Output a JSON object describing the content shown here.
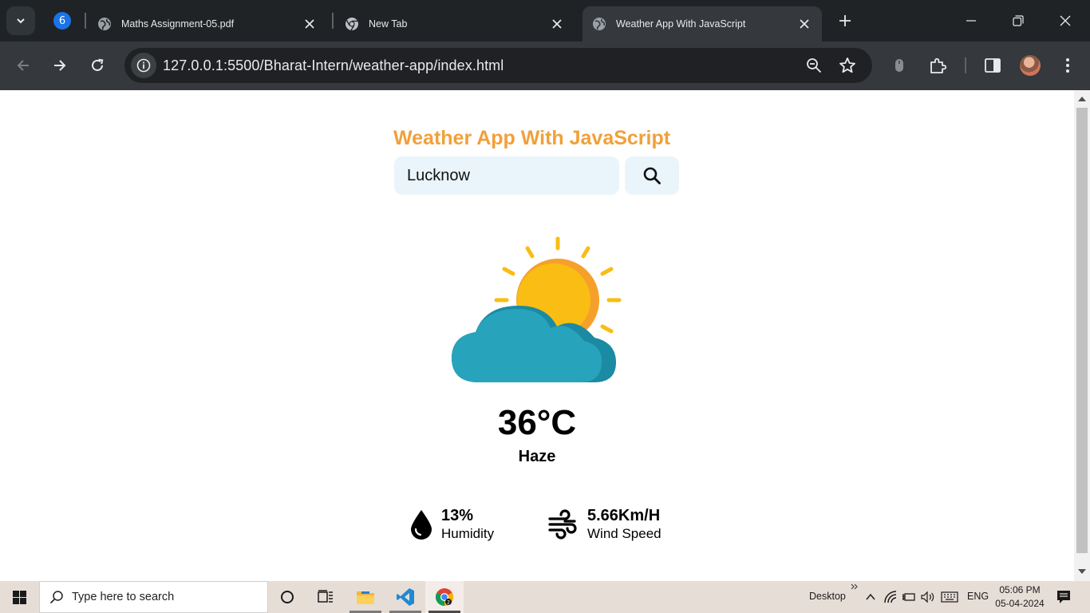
{
  "browser": {
    "tab_group_count": "6",
    "tabs": [
      {
        "title": "Maths Assignment-05.pdf",
        "icon": "globe-icon"
      },
      {
        "title": "New Tab",
        "icon": "chrome-icon"
      },
      {
        "title": "Weather App With JavaScript",
        "icon": "globe-icon",
        "active": true
      }
    ],
    "url": "127.0.0.1:5500/Bharat-Intern/weather-app/index.html"
  },
  "app": {
    "title": "Weather App With JavaScript",
    "search_value": "Lucknow",
    "weather_icon": "sun-behind-cloud",
    "temperature": "36°C",
    "description": "Haze",
    "humidity": {
      "value": "13%",
      "label": "Humidity",
      "icon": "water-drop-icon"
    },
    "wind": {
      "value": "5.66Km/H",
      "label": "Wind Speed",
      "icon": "wind-icon"
    }
  },
  "taskbar": {
    "search_placeholder": "Type here to search",
    "desktop_label": "Desktop",
    "language": "ENG",
    "time": "05:06 PM",
    "date": "05-04-2024"
  },
  "colors": {
    "title": "#f1a03a",
    "input_bg": "#eaf4fb",
    "sun": "#f9bd13",
    "cloud": "#27a3bb"
  }
}
